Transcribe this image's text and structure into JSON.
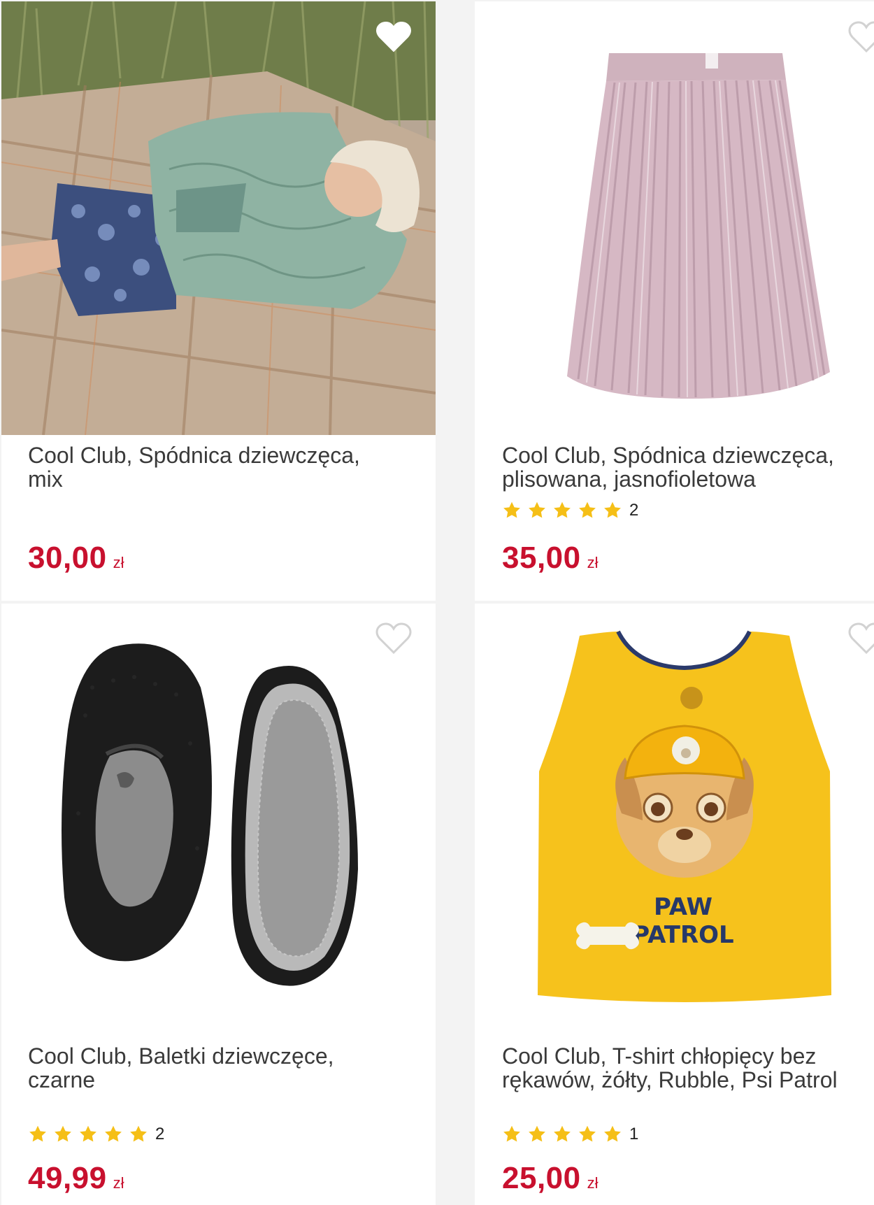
{
  "products": [
    {
      "title": "Cool Club, Spódnica dziewczęca, mix",
      "price": "30,00",
      "currency": "zł",
      "favorited": true,
      "image": "girl-in-jacket-on-blanket-photo"
    },
    {
      "title": "Cool Club, Spódnica dziewczęca, plisowana, jasnofioletowa",
      "price": "35,00",
      "currency": "zł",
      "rating": 5,
      "review_count": "2",
      "favorited": false,
      "image": "pleated-lilac-skirt-photo"
    },
    {
      "title": "Cool Club, Baletki dziewczęce, czarne",
      "price": "49,99",
      "currency": "zł",
      "rating": 5,
      "review_count": "2",
      "favorited": false,
      "image": "black-ballet-shoes-photo"
    },
    {
      "title": "Cool Club, T-shirt chłopięcy bez rękawów, żółty, Rubble, Psi Patrol",
      "price": "25,00",
      "currency": "zł",
      "rating": 5,
      "review_count": "1",
      "favorited": false,
      "image": "yellow-paw-patrol-tank-top-photo",
      "print_text": "PAW PATROL"
    }
  ],
  "colors": {
    "price": "#c8102e",
    "star": "#f5bf17",
    "background": "#f3f3f3",
    "card": "#ffffff"
  }
}
